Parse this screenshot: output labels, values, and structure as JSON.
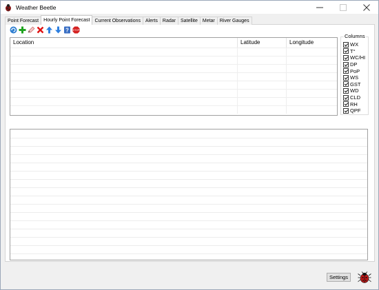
{
  "window": {
    "title": "Weather Beetle",
    "app_icon": "beetle-icon",
    "controls": [
      "minimize",
      "maximize",
      "close"
    ]
  },
  "tabs": [
    {
      "label": "Point Forecast",
      "active": false
    },
    {
      "label": "Hourly Point Forecast",
      "active": true
    },
    {
      "label": "Current Observations",
      "active": false
    },
    {
      "label": "Alerts",
      "active": false
    },
    {
      "label": "Radar",
      "active": false
    },
    {
      "label": "Satellite",
      "active": false
    },
    {
      "label": "Metar",
      "active": false
    },
    {
      "label": "River Gauges",
      "active": false
    }
  ],
  "toolbar": {
    "icons": [
      "refresh-icon",
      "add-icon",
      "edit-icon",
      "delete-icon",
      "move-up-icon",
      "move-down-icon",
      "help-icon",
      "stop-icon"
    ],
    "stop_text": "STOP"
  },
  "locations_table": {
    "headers": [
      "Location",
      "Latitude",
      "Longitude"
    ],
    "rows": []
  },
  "columns": {
    "legend": "Columns",
    "items": [
      {
        "label": "WX",
        "checked": true
      },
      {
        "label": "T°",
        "checked": true
      },
      {
        "label": "WC/HI",
        "checked": true
      },
      {
        "label": "DP",
        "checked": true
      },
      {
        "label": "PoP",
        "checked": true
      },
      {
        "label": "WS",
        "checked": true
      },
      {
        "label": "GST",
        "checked": true
      },
      {
        "label": "WD",
        "checked": true
      },
      {
        "label": "CLD",
        "checked": true
      },
      {
        "label": "RH",
        "checked": true
      },
      {
        "label": "QPF",
        "checked": true
      }
    ]
  },
  "footer": {
    "settings_label": "Settings",
    "logo_icon": "beetle-logo-icon"
  },
  "colors": {
    "window_bg": "#f0f0f0",
    "refresh_blue": "#2f7fd0",
    "add_green": "#1fa31f",
    "delete_red": "#e01010",
    "arrow_blue": "#2d7fe0",
    "stop_red": "#d42020"
  }
}
